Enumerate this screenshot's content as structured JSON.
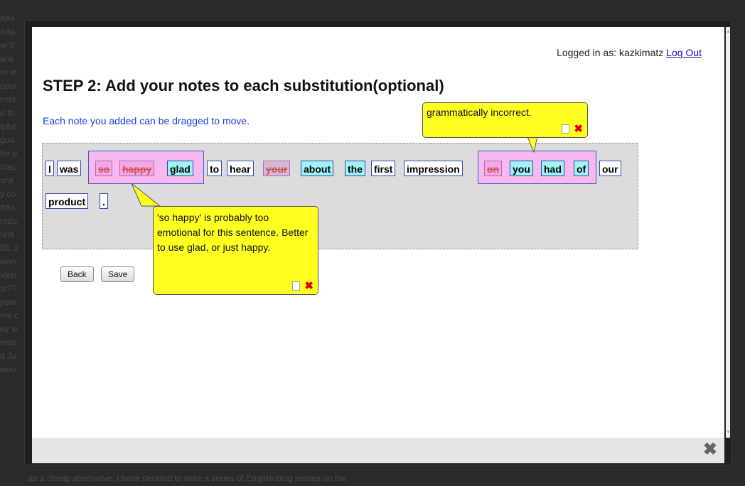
{
  "header": {
    "logged_in_prefix": "Logged in as: kazkimatz",
    "logout_label": "Log Out"
  },
  "step": {
    "title": "STEP 2: Add your notes to each substitution(optional)",
    "hint": "Each note you added can be dragged to move."
  },
  "tokens": [
    {
      "id": "t1",
      "text": "I"
    },
    {
      "id": "t2",
      "text": "was"
    },
    {
      "id": "t3",
      "text": "so"
    },
    {
      "id": "t4",
      "text": "happy"
    },
    {
      "id": "t5",
      "text": "glad"
    },
    {
      "id": "t6",
      "text": "to"
    },
    {
      "id": "t7",
      "text": "hear"
    },
    {
      "id": "t8",
      "text": "your"
    },
    {
      "id": "t9",
      "text": "about"
    },
    {
      "id": "t10",
      "text": "the"
    },
    {
      "id": "t11",
      "text": "first"
    },
    {
      "id": "t12",
      "text": "impression"
    },
    {
      "id": "t13",
      "text": "on"
    },
    {
      "id": "t14",
      "text": "you"
    },
    {
      "id": "t15",
      "text": "had"
    },
    {
      "id": "t16",
      "text": "of"
    },
    {
      "id": "t17",
      "text": "our"
    },
    {
      "id": "t18",
      "text": "product"
    },
    {
      "id": "t19",
      "text": "."
    }
  ],
  "notes": {
    "note1": {
      "text": "grammatically incorrect."
    },
    "note2": {
      "text": "'so happy' is probably too emotional for this sentence. Better to use glad, or just happy."
    }
  },
  "buttons": {
    "back": "Back",
    "save": "Save"
  },
  "background": {
    "left_lines": [
      "rtAs",
      "rtAs",
      "ar E",
      "ank",
      "re in",
      "cour",
      "nsid",
      "d th",
      "lpful",
      "gua",
      "for p",
      "ntac",
      "ank",
      "y co",
      "rtAs",
      "rodu",
      "first",
      "08, 2",
      "icon",
      "iden",
      "at??",
      "year",
      "me c",
      "ey w",
      "nsta",
      "d Ja",
      "wou"
    ],
    "bottom_line": "as a cheap alternative, I have decided to write a series of English blog entries on the"
  }
}
